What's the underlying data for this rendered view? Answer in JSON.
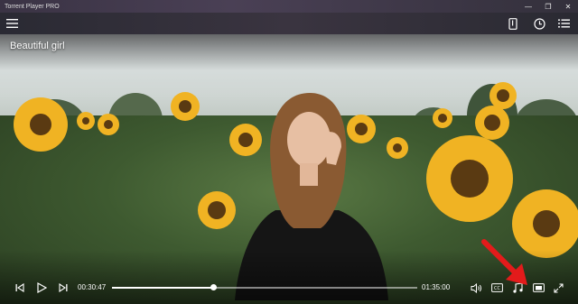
{
  "window": {
    "title": "Torrent Player PRO"
  },
  "window_controls": {
    "minimize": "—",
    "maximize": "❐",
    "close": "✕"
  },
  "toolbar": {
    "menu_icon": "hamburger-menu-icon",
    "right_icons": [
      "phone-portrait-icon",
      "history-clock-icon",
      "playlist-icon"
    ]
  },
  "video": {
    "title": "Beautiful girl"
  },
  "player": {
    "current_time": "00:30:47",
    "total_time": "01:35:00",
    "progress": 0.33,
    "icons": [
      "skip-previous-icon",
      "play-icon",
      "skip-next-icon",
      "volume-icon",
      "subtitles-cc-icon",
      "audio-track-icon",
      "picture-in-picture-icon",
      "fullscreen-icon"
    ]
  },
  "colors": {
    "annotation_arrow": "#e31b1b",
    "titlebar": "#3a3344"
  }
}
